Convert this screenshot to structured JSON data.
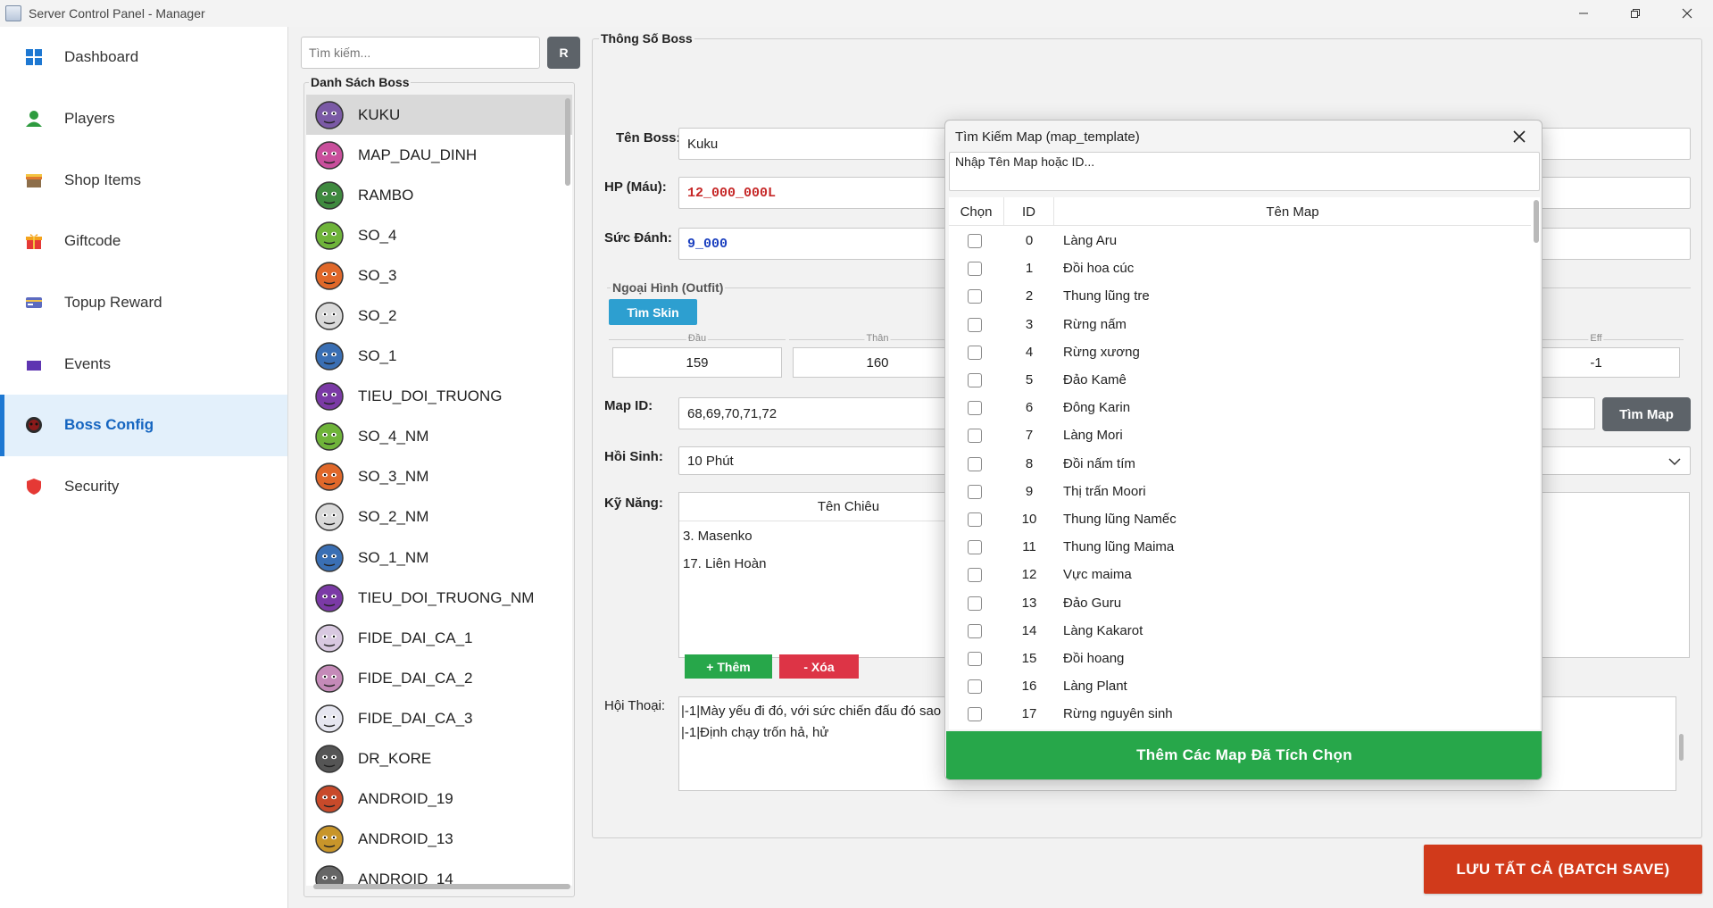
{
  "window": {
    "title": "Server Control Panel - Manager"
  },
  "sidebar": {
    "items": [
      {
        "label": "Dashboard",
        "icon": "grid-icon",
        "color": "#1e78d2"
      },
      {
        "label": "Players",
        "icon": "user-icon",
        "color": "#2e9b3f"
      },
      {
        "label": "Shop Items",
        "icon": "shop-icon",
        "color": "#e07a2e"
      },
      {
        "label": "Giftcode",
        "icon": "gift-icon",
        "color": "#e53935"
      },
      {
        "label": "Topup Reward",
        "icon": "card-icon",
        "color": "#5c6bc0"
      },
      {
        "label": "Events",
        "icon": "calendar-icon",
        "color": "#5e35b1"
      },
      {
        "label": "Boss Config",
        "icon": "boss-icon",
        "color": "#8b1a1a",
        "active": true
      },
      {
        "label": "Security",
        "icon": "shield-icon",
        "color": "#e53935"
      }
    ]
  },
  "boss_list": {
    "search_placeholder": "Tìm kiếm...",
    "refresh_label": "R",
    "group_title": "Danh Sách Boss",
    "selected_index": 0,
    "items": [
      {
        "name": "KUKU",
        "color": "#7b5aa6"
      },
      {
        "name": "MAP_DAU_DINH",
        "color": "#c94f9c"
      },
      {
        "name": "RAMBO",
        "color": "#3f8a3f"
      },
      {
        "name": "SO_4",
        "color": "#6fb43a"
      },
      {
        "name": "SO_3",
        "color": "#e0682a"
      },
      {
        "name": "SO_2",
        "color": "#d9d9d9"
      },
      {
        "name": "SO_1",
        "color": "#3a6fb4"
      },
      {
        "name": "TIEU_DOI_TRUONG",
        "color": "#7b3aa6"
      },
      {
        "name": "SO_4_NM",
        "color": "#6fb43a"
      },
      {
        "name": "SO_3_NM",
        "color": "#e0682a"
      },
      {
        "name": "SO_2_NM",
        "color": "#d9d9d9"
      },
      {
        "name": "SO_1_NM",
        "color": "#3a6fb4"
      },
      {
        "name": "TIEU_DOI_TRUONG_NM",
        "color": "#7b3aa6"
      },
      {
        "name": "FIDE_DAI_CA_1",
        "color": "#d8c8e0"
      },
      {
        "name": "FIDE_DAI_CA_2",
        "color": "#c48ab8"
      },
      {
        "name": "FIDE_DAI_CA_3",
        "color": "#e6e6f0"
      },
      {
        "name": "DR_KORE",
        "color": "#555555"
      },
      {
        "name": "ANDROID_19",
        "color": "#c84a2a"
      },
      {
        "name": "ANDROID_13",
        "color": "#c8952a"
      },
      {
        "name": "ANDROID_14",
        "color": "#666666"
      }
    ]
  },
  "params": {
    "group_title": "Thông Số Boss",
    "name_label": "Tên Boss:",
    "name_value": "Kuku",
    "hp_label": "HP (Máu):",
    "hp_value": "12_000_000L",
    "hp_color": "#c62828",
    "dmg_label": "Sức Đánh:",
    "dmg_value": "9_000",
    "dmg_color": "#1a3fbf",
    "outfit_title": "Ngoại Hình (Outfit)",
    "find_skin_label": "Tìm Skin",
    "outfit_head_label": "Đầu",
    "outfit_head_value": "159",
    "outfit_body_label": "Thân",
    "outfit_body_value": "160",
    "outfit_eff_label": "Eff",
    "outfit_eff_value": "-1",
    "map_label": "Map ID:",
    "map_value": "68,69,70,71,72",
    "find_map_label": "Tìm Map",
    "respawn_label": "Hồi Sinh:",
    "respawn_value": "10 Phút",
    "skill_label": "Kỹ Năng:",
    "skill_col": "Tên Chiêu",
    "skills": [
      "3. Masenko",
      "17. Liên Hoàn"
    ],
    "add_skill_label": "+ Thêm",
    "del_skill_label": "- Xóa",
    "dialog_label": "Hội Thoại:",
    "dialog_lines": [
      "|-1|Mày yếu đi đó, với sức chiến đấu đó sao",
      "|-1|Định chạy trốn hả, hử"
    ],
    "save_all_label": "LƯU TẤT CẢ (BATCH SAVE)"
  },
  "modal": {
    "title": "Tìm Kiếm Map (map_template)",
    "search_label": "Nhập Tên Map hoặc ID...",
    "col_select": "Chọn",
    "col_id": "ID",
    "col_name": "Tên Map",
    "rows": [
      {
        "id": "0",
        "name": "Làng Aru"
      },
      {
        "id": "1",
        "name": "Đồi hoa cúc"
      },
      {
        "id": "2",
        "name": "Thung lũng tre"
      },
      {
        "id": "3",
        "name": "Rừng nấm"
      },
      {
        "id": "4",
        "name": "Rừng xương"
      },
      {
        "id": "5",
        "name": "Đảo Kamê"
      },
      {
        "id": "6",
        "name": "Đông Karin"
      },
      {
        "id": "7",
        "name": "Làng Mori"
      },
      {
        "id": "8",
        "name": "Đồi nấm tím"
      },
      {
        "id": "9",
        "name": "Thị trấn Moori"
      },
      {
        "id": "10",
        "name": "Thung lũng Namếc"
      },
      {
        "id": "11",
        "name": "Thung lũng Maima"
      },
      {
        "id": "12",
        "name": "Vực maima"
      },
      {
        "id": "13",
        "name": "Đảo Guru"
      },
      {
        "id": "14",
        "name": "Làng Kakarot"
      },
      {
        "id": "15",
        "name": "Đồi hoang"
      },
      {
        "id": "16",
        "name": "Làng Plant"
      },
      {
        "id": "17",
        "name": "Rừng nguyên sinh"
      }
    ],
    "add_button_label": "Thêm Các Map Đã Tích Chọn"
  }
}
